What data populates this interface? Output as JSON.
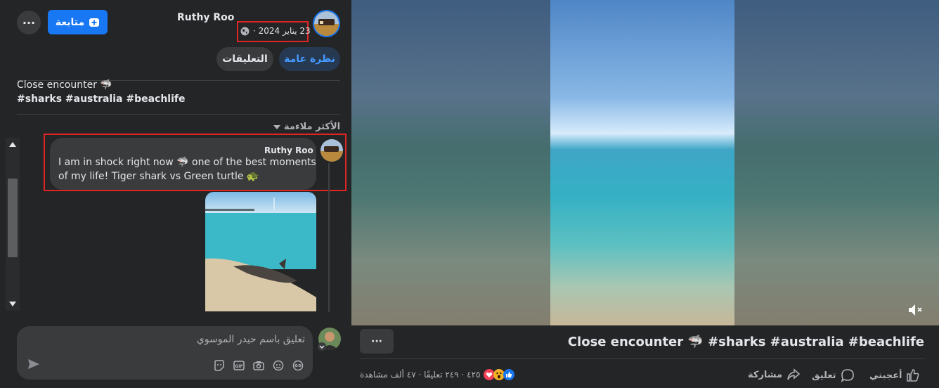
{
  "author": {
    "name": "Ruthy Roo",
    "date": "23 يناير 2024 ·",
    "follow_label": "متابعة"
  },
  "tabs": {
    "overview": "نظرة عامة",
    "comments": "التعليقات"
  },
  "post": {
    "caption": "Close encounter 🦈",
    "hashtags": "#sharks #australia #beachlife"
  },
  "sort_label": "الأكثر ملاءمة",
  "comment": {
    "author": "Ruthy Roo",
    "text_line1": "I am in shock right now 🦈 one of the best moments",
    "text_line2": "of my life! Tiger shark vs Green turtle 🐢"
  },
  "composer": {
    "placeholder": "تعليق باسم حيدر الموسوي"
  },
  "video_title": "Close encounter 🦈 #sharks #australia #beachlife",
  "stats": {
    "text": "٤٢٥ · ٢٤٩ تعليقًا · ٤٧ ألف مشاهدة"
  },
  "actions": {
    "like": "أعجبني",
    "comment": "تعليق",
    "share": "مشاركة"
  },
  "more_label": "···",
  "colors": {
    "accent": "#1877f2",
    "highlight": "#e02424",
    "background": "#242526"
  }
}
